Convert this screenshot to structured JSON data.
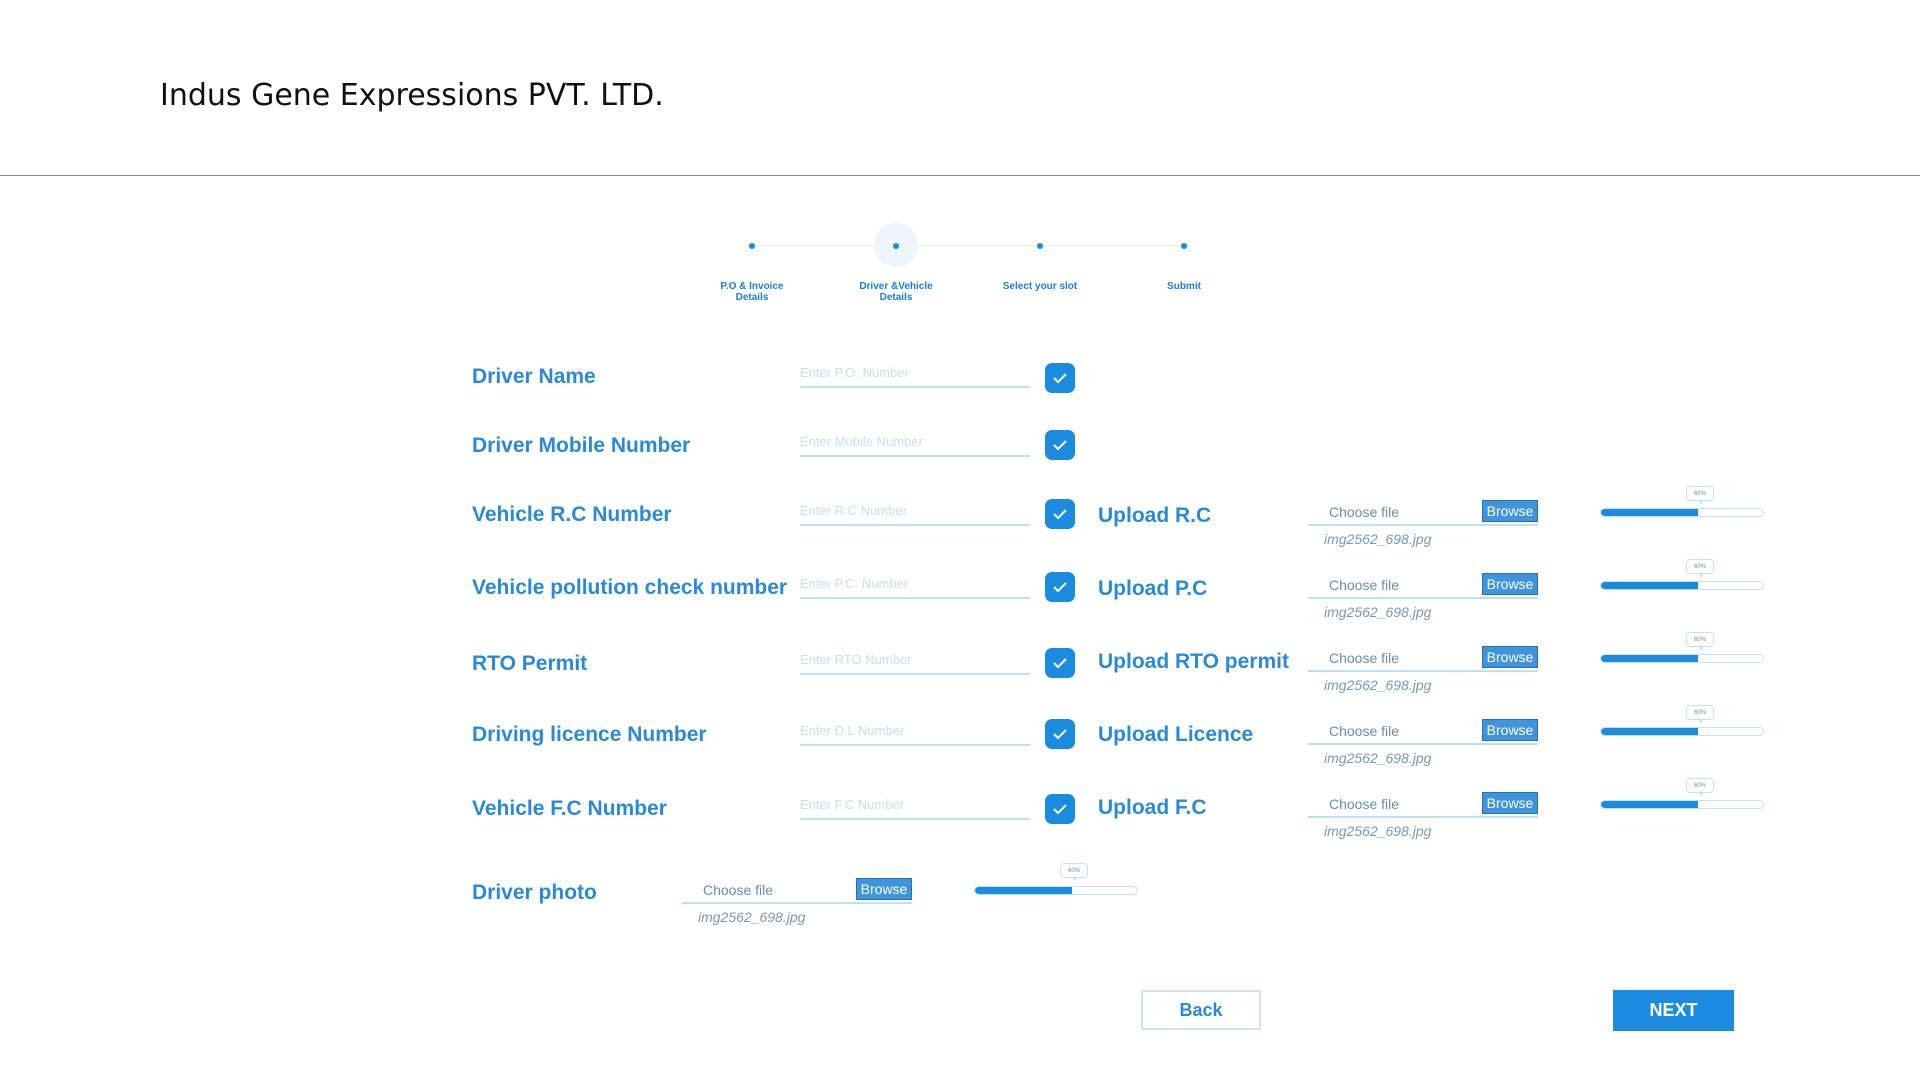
{
  "header": {
    "company_name": "Indus Gene Expressions PVT. LTD."
  },
  "stepper": {
    "active_step": 2,
    "steps": [
      {
        "label_line1": "P.O & Invoice",
        "label_line2": "Details"
      },
      {
        "label_line1": "Driver &Vehicle",
        "label_line2": "Details"
      },
      {
        "label_line1": "Select your slot",
        "label_line2": ""
      },
      {
        "label_line1": "Submit",
        "label_line2": ""
      }
    ]
  },
  "form": {
    "fields": [
      {
        "label": "Driver Name",
        "placeholder": "Enter P.O. Number",
        "value": ""
      },
      {
        "label": "Driver Mobile Number",
        "placeholder": "Enter Mobile Number",
        "value": ""
      },
      {
        "label": "Vehicle R.C Number",
        "placeholder": "Enter R.C Number",
        "value": ""
      },
      {
        "label": "Vehicle pollution check number",
        "placeholder": "Enter P.C. Number",
        "value": ""
      },
      {
        "label": "RTO Permit",
        "placeholder": "Enter RTO Number",
        "value": ""
      },
      {
        "label": "Driving licence Number",
        "placeholder": "Enter D.L Number",
        "value": ""
      },
      {
        "label": "Vehicle F.C Number",
        "placeholder": "Enter F.C Number",
        "value": ""
      }
    ],
    "uploads": [
      {
        "label": "Upload R.C",
        "choose_text": "Choose file",
        "browse_label": "Browse",
        "file_name": "img2562_698.jpg",
        "progress_text": "60%",
        "progress": 0.6
      },
      {
        "label": "Upload P.C",
        "choose_text": "Choose file",
        "browse_label": "Browse",
        "file_name": "img2562_698.jpg",
        "progress_text": "60%",
        "progress": 0.6
      },
      {
        "label": "Upload RTO permit",
        "choose_text": "Choose file",
        "browse_label": "Browse",
        "file_name": "img2562_698.jpg",
        "progress_text": "60%",
        "progress": 0.6
      },
      {
        "label": "Upload Licence",
        "choose_text": "Choose file",
        "browse_label": "Browse",
        "file_name": "img2562_698.jpg",
        "progress_text": "60%",
        "progress": 0.6
      },
      {
        "label": "Upload F.C",
        "choose_text": "Choose file",
        "browse_label": "Browse",
        "file_name": "img2562_698.jpg",
        "progress_text": "60%",
        "progress": 0.6
      }
    ],
    "driver_photo": {
      "label": "Driver photo",
      "choose_text": "Choose file",
      "browse_label": "Browse",
      "file_name": "img2562_698.jpg",
      "progress_text": "60%",
      "progress": 0.6
    }
  },
  "buttons": {
    "back_label": "Back",
    "next_label": "NEXT"
  },
  "colors": {
    "accent": "#1b8be0",
    "label": "#2a8ad6",
    "input_border": "#bfe0f4"
  },
  "icons": {
    "check": "check-icon"
  }
}
